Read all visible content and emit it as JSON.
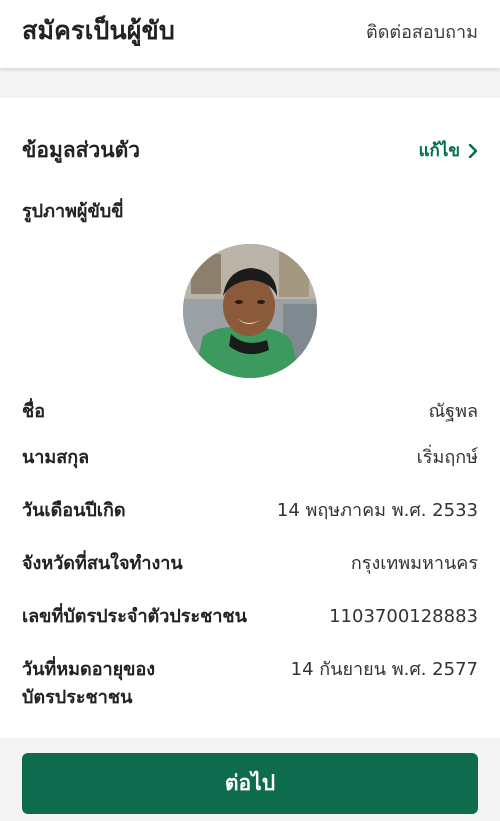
{
  "header": {
    "title": "สมัครเป็นผู้ขับ",
    "contact_link": "ติดต่อสอบถาม"
  },
  "personal_info": {
    "section_title": "ข้อมูลส่วนตัว",
    "edit_label": "แก้ไข",
    "photo_label": "รูปภาพผู้ขับขี่",
    "fields": [
      {
        "label": "ชื่อ",
        "value": "ณัฐพล"
      },
      {
        "label": "นามสกุล",
        "value": "เริ่มฤกษ์"
      },
      {
        "label": "วันเดือนปีเกิด",
        "value": "14 พฤษภาคม พ.ศ. 2533"
      },
      {
        "label": "จังหวัดที่สนใจทำงาน",
        "value": "กรุงเทพมหานคร"
      },
      {
        "label": "เลขที่บัตรประจำตัวประชาชน",
        "value": "1103700128883"
      },
      {
        "label": "วันที่หมดอายุของ\nบัตรประชาชน",
        "value": "14 กันยายน พ.ศ. 2577"
      }
    ]
  },
  "footer": {
    "next_label": "ต่อไป"
  },
  "colors": {
    "accent": "#0e6b4d",
    "edit_link": "#00704a",
    "background": "#f4f4f4"
  }
}
